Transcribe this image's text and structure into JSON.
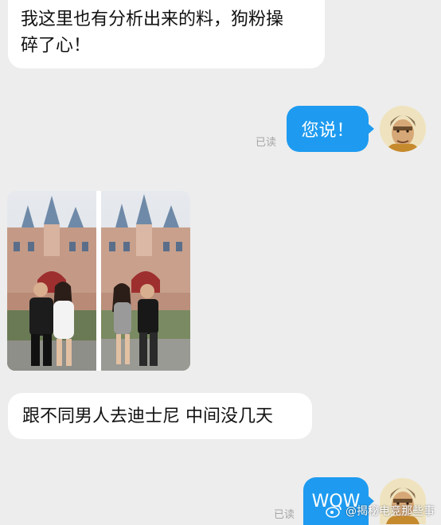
{
  "messages": {
    "first_text": "我这里也有分析出来的料，狗粉操碎了心！",
    "first_line1": "我这里也有分析出来的料，狗粉操",
    "first_line2": "碎了心！",
    "reply1_text": "您说！",
    "reply1_status": "已读",
    "second_text": "跟不同男人去迪士尼 中间没几天",
    "reply2_text": "WOW",
    "reply2_status": "已读"
  },
  "photo": {
    "description_icon": "castle-photo"
  },
  "watermark": {
    "icon": "weibo-logo",
    "text": "@揭秘电竞那些事"
  },
  "colors": {
    "background": "#ededed",
    "bubble_left": "#ffffff",
    "bubble_right": "#1e9bf0",
    "read_status": "#a6a6a6"
  }
}
